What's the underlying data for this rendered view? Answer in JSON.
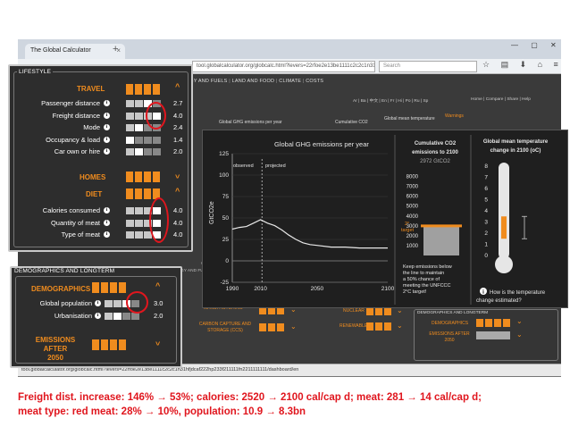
{
  "browser": {
    "tab_title": "The Global Calculator",
    "url": "tool.globalcalculator.org/globcalc.html?levers=22rfoe2e13be1111c2c2c1n31hfjdcaf222hp233f211111fn2211111111/dashboard/en",
    "search_placeholder": "Search",
    "status_url": "tool.globalcalculator.org/globcalc.html?levers=22rfoe2e13be1111c2c2c1n31hfjdcaf222hp233f211111fn2211111111/dashboard/en"
  },
  "nav": {
    "items": [
      "OLOGY AND FUELS",
      "LAND AND FOOD",
      "CLIMATE",
      "COSTS"
    ],
    "languages": "Ar | Ba | 中文 | En | Fr | Hi | Po | Ru | Sp",
    "right_links": "Home  |  Compare  |  Share  |  Help",
    "col_headers": [
      "Global GHG emissions per year",
      "Cumulative CO2",
      "Global mean temperature"
    ],
    "warning": "Warnings"
  },
  "lifestyle": {
    "title": "LIFESTYLE",
    "travel": "TRAVEL",
    "homes": "HOMES",
    "diet": "DIET",
    "rows": [
      {
        "label": "Passenger distance",
        "value": "2.7",
        "sel": 2
      },
      {
        "label": "Freight distance",
        "value": "4.0",
        "sel": 3
      },
      {
        "label": "Mode",
        "value": "2.4",
        "sel": 1
      },
      {
        "label": "Occupancy & load",
        "value": "1.4",
        "sel": 0
      },
      {
        "label": "Car own or hire",
        "value": "2.0",
        "sel": 1
      }
    ],
    "diet_rows": [
      {
        "label": "Calories consumed",
        "value": "4.0",
        "sel": 3
      },
      {
        "label": "Quantity of meat",
        "value": "4.0",
        "sel": 3
      },
      {
        "label": "Type of meat",
        "value": "4.0",
        "sel": 3
      }
    ]
  },
  "demographics": {
    "title": "DEMOGRAPHICS AND LONGTERM",
    "demographics": "DEMOGRAPHICS",
    "rows": [
      {
        "label": "Global population",
        "value": "3.0",
        "sel": 2
      },
      {
        "label": "Urbanisation",
        "value": "2.0",
        "sel": 1
      }
    ],
    "emissions_after": "EMISSIONS AFTER 2050",
    "emissions_after_l1": "EMISSIONS AFTER",
    "emissions_after_l2": "2050"
  },
  "background": {
    "manufacturing": "MANUFACTURING",
    "ccs": "CARBON CAPTURE AND STORAGE (CCS)",
    "nuclear": "NUCLEAR",
    "renewables": "RENEWABLES",
    "demo_title": "DEMOGRAPHICS AND LONGTERM",
    "demo_item": "DEMOGRAPHICS",
    "emis_item": "EMISSIONS AFTER 2050",
    "choose_hint": "Choose an example pathway or create your own pathway by selecting effort level 1 to 4",
    "fragment": "GY AND FUE"
  },
  "ghg_chart": {
    "title": "Global GHG emissions per year",
    "ylabel": "GtCO2e",
    "observed": "observed",
    "projected": "projected"
  },
  "chart_data": {
    "type": "line",
    "title": "Global GHG emissions per year",
    "ylabel": "GtCO2e",
    "ylim": [
      -25,
      125
    ],
    "yticks": [
      -25,
      0,
      25,
      50,
      75,
      100,
      125
    ],
    "xlim": [
      1990,
      2100
    ],
    "xticks": [
      1990,
      2010,
      2050,
      2100
    ],
    "divider_year": 2011,
    "series": [
      {
        "x": [
          1990,
          1995,
          2000,
          2005,
          2010,
          2015,
          2020,
          2025,
          2030,
          2035,
          2040,
          2045,
          2050,
          2060,
          2070,
          2080,
          2090,
          2100
        ],
        "values": [
          37,
          39,
          40,
          44,
          48,
          44,
          41,
          36,
          30,
          25,
          21,
          19,
          18,
          16,
          16,
          15,
          15,
          15
        ]
      }
    ]
  },
  "cumulative": {
    "title_l1": "Cumulative CO2",
    "title_l2": "emissions to 2100",
    "total": "2972 GtCO2",
    "yticks": [
      1000,
      2000,
      3000,
      4000,
      5000,
      6000,
      7000,
      8000
    ],
    "value": 2972,
    "target_value": 3000,
    "target_label": "2°",
    "target_label2": "target",
    "note_l1": "Keep emissions below",
    "note_l2": "the line to maintain",
    "note_l3": "a 50% chance of",
    "note_l4": "meeting the UNFCCC",
    "note_l5": "2°C target!"
  },
  "temperature": {
    "title_l1": "Global mean temperature",
    "title_l2": "change in 2100 (oC)",
    "yticks": [
      0,
      1,
      2,
      3,
      4,
      5,
      6,
      7,
      8
    ],
    "range_low": 1.5,
    "range_high": 3.5,
    "question_l1": "How is the temperature",
    "question_l2": "change estimated?"
  },
  "caption": {
    "line1": "Freight dist. increase: 146% → 53%; calories: 2520 → 2100 cal/cap d; meat: 281 → 14 cal/cap d;",
    "line2": "meat type: red meat: 28% → 10%, population: 10.9 → 8.3bn"
  },
  "colors": {
    "accent": "#f08c1e",
    "highlight": "#e0161e",
    "panel": "#2d2d2d"
  }
}
